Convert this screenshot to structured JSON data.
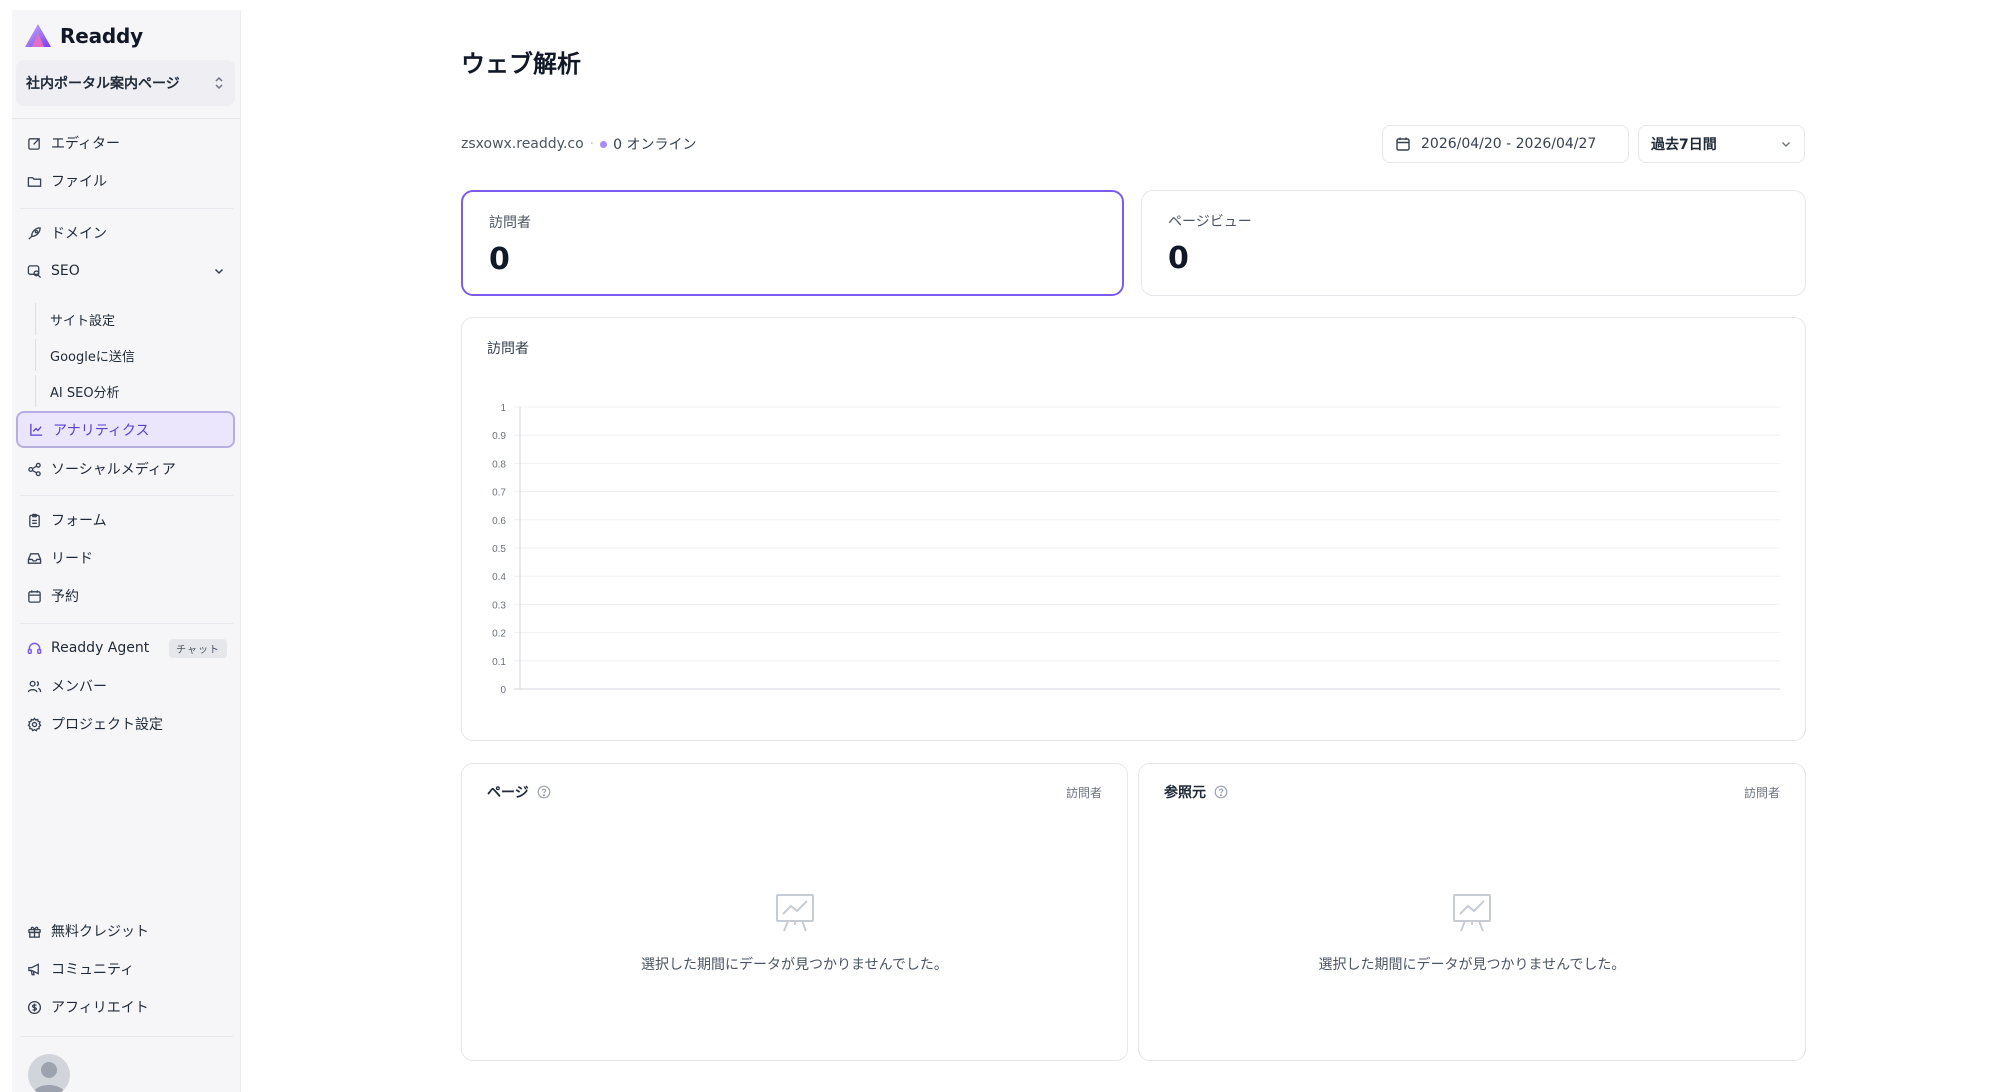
{
  "app": {
    "name": "Readdy"
  },
  "project": {
    "name": "社内ポータル案内ページ"
  },
  "sidebar": {
    "items": [
      {
        "label": "エディター"
      },
      {
        "label": "ファイル"
      },
      {
        "label": "ドメイン"
      },
      {
        "label": "SEO"
      },
      {
        "label": "アナリティクス"
      },
      {
        "label": "ソーシャルメディア"
      },
      {
        "label": "フォーム"
      },
      {
        "label": "リード"
      },
      {
        "label": "予約"
      },
      {
        "label": "Readdy Agent",
        "badge": "チャット"
      },
      {
        "label": "メンバー"
      },
      {
        "label": "プロジェクト設定"
      },
      {
        "label": "無料クレジット"
      },
      {
        "label": "コミュニティ"
      },
      {
        "label": "アフィリエイト"
      }
    ],
    "seo_sub": [
      {
        "label": "サイト設定"
      },
      {
        "label": "Googleに送信"
      },
      {
        "label": "AI SEO分析"
      }
    ]
  },
  "main": {
    "title": "ウェブ解析",
    "site": "zsxowx.readdy.co",
    "online": "0 オンライン",
    "date_range": "2026/04/20 - 2026/04/27",
    "period": "過去7日間",
    "stats": [
      {
        "label": "訪問者",
        "value": "0"
      },
      {
        "label": "ページビュー",
        "value": "0"
      }
    ],
    "chart_label": "訪問者",
    "pages_card": {
      "title": "ページ",
      "column": "訪問者",
      "empty": "選択した期間にデータが見つかりませんでした。"
    },
    "referrers_card": {
      "title": "参照元",
      "column": "訪問者",
      "empty": "選択した期間にデータが見つかりませんでした。"
    }
  },
  "accent_color": "#7c5cf0",
  "chart_data": {
    "type": "line",
    "title": "訪問者",
    "x": [],
    "series": [],
    "yticks": [
      "0",
      "0.1",
      "0.2",
      "0.3",
      "0.4",
      "0.5",
      "0.6",
      "0.7",
      "0.8",
      "0.9",
      "1"
    ],
    "ylim": [
      0,
      1
    ],
    "grid": true
  }
}
